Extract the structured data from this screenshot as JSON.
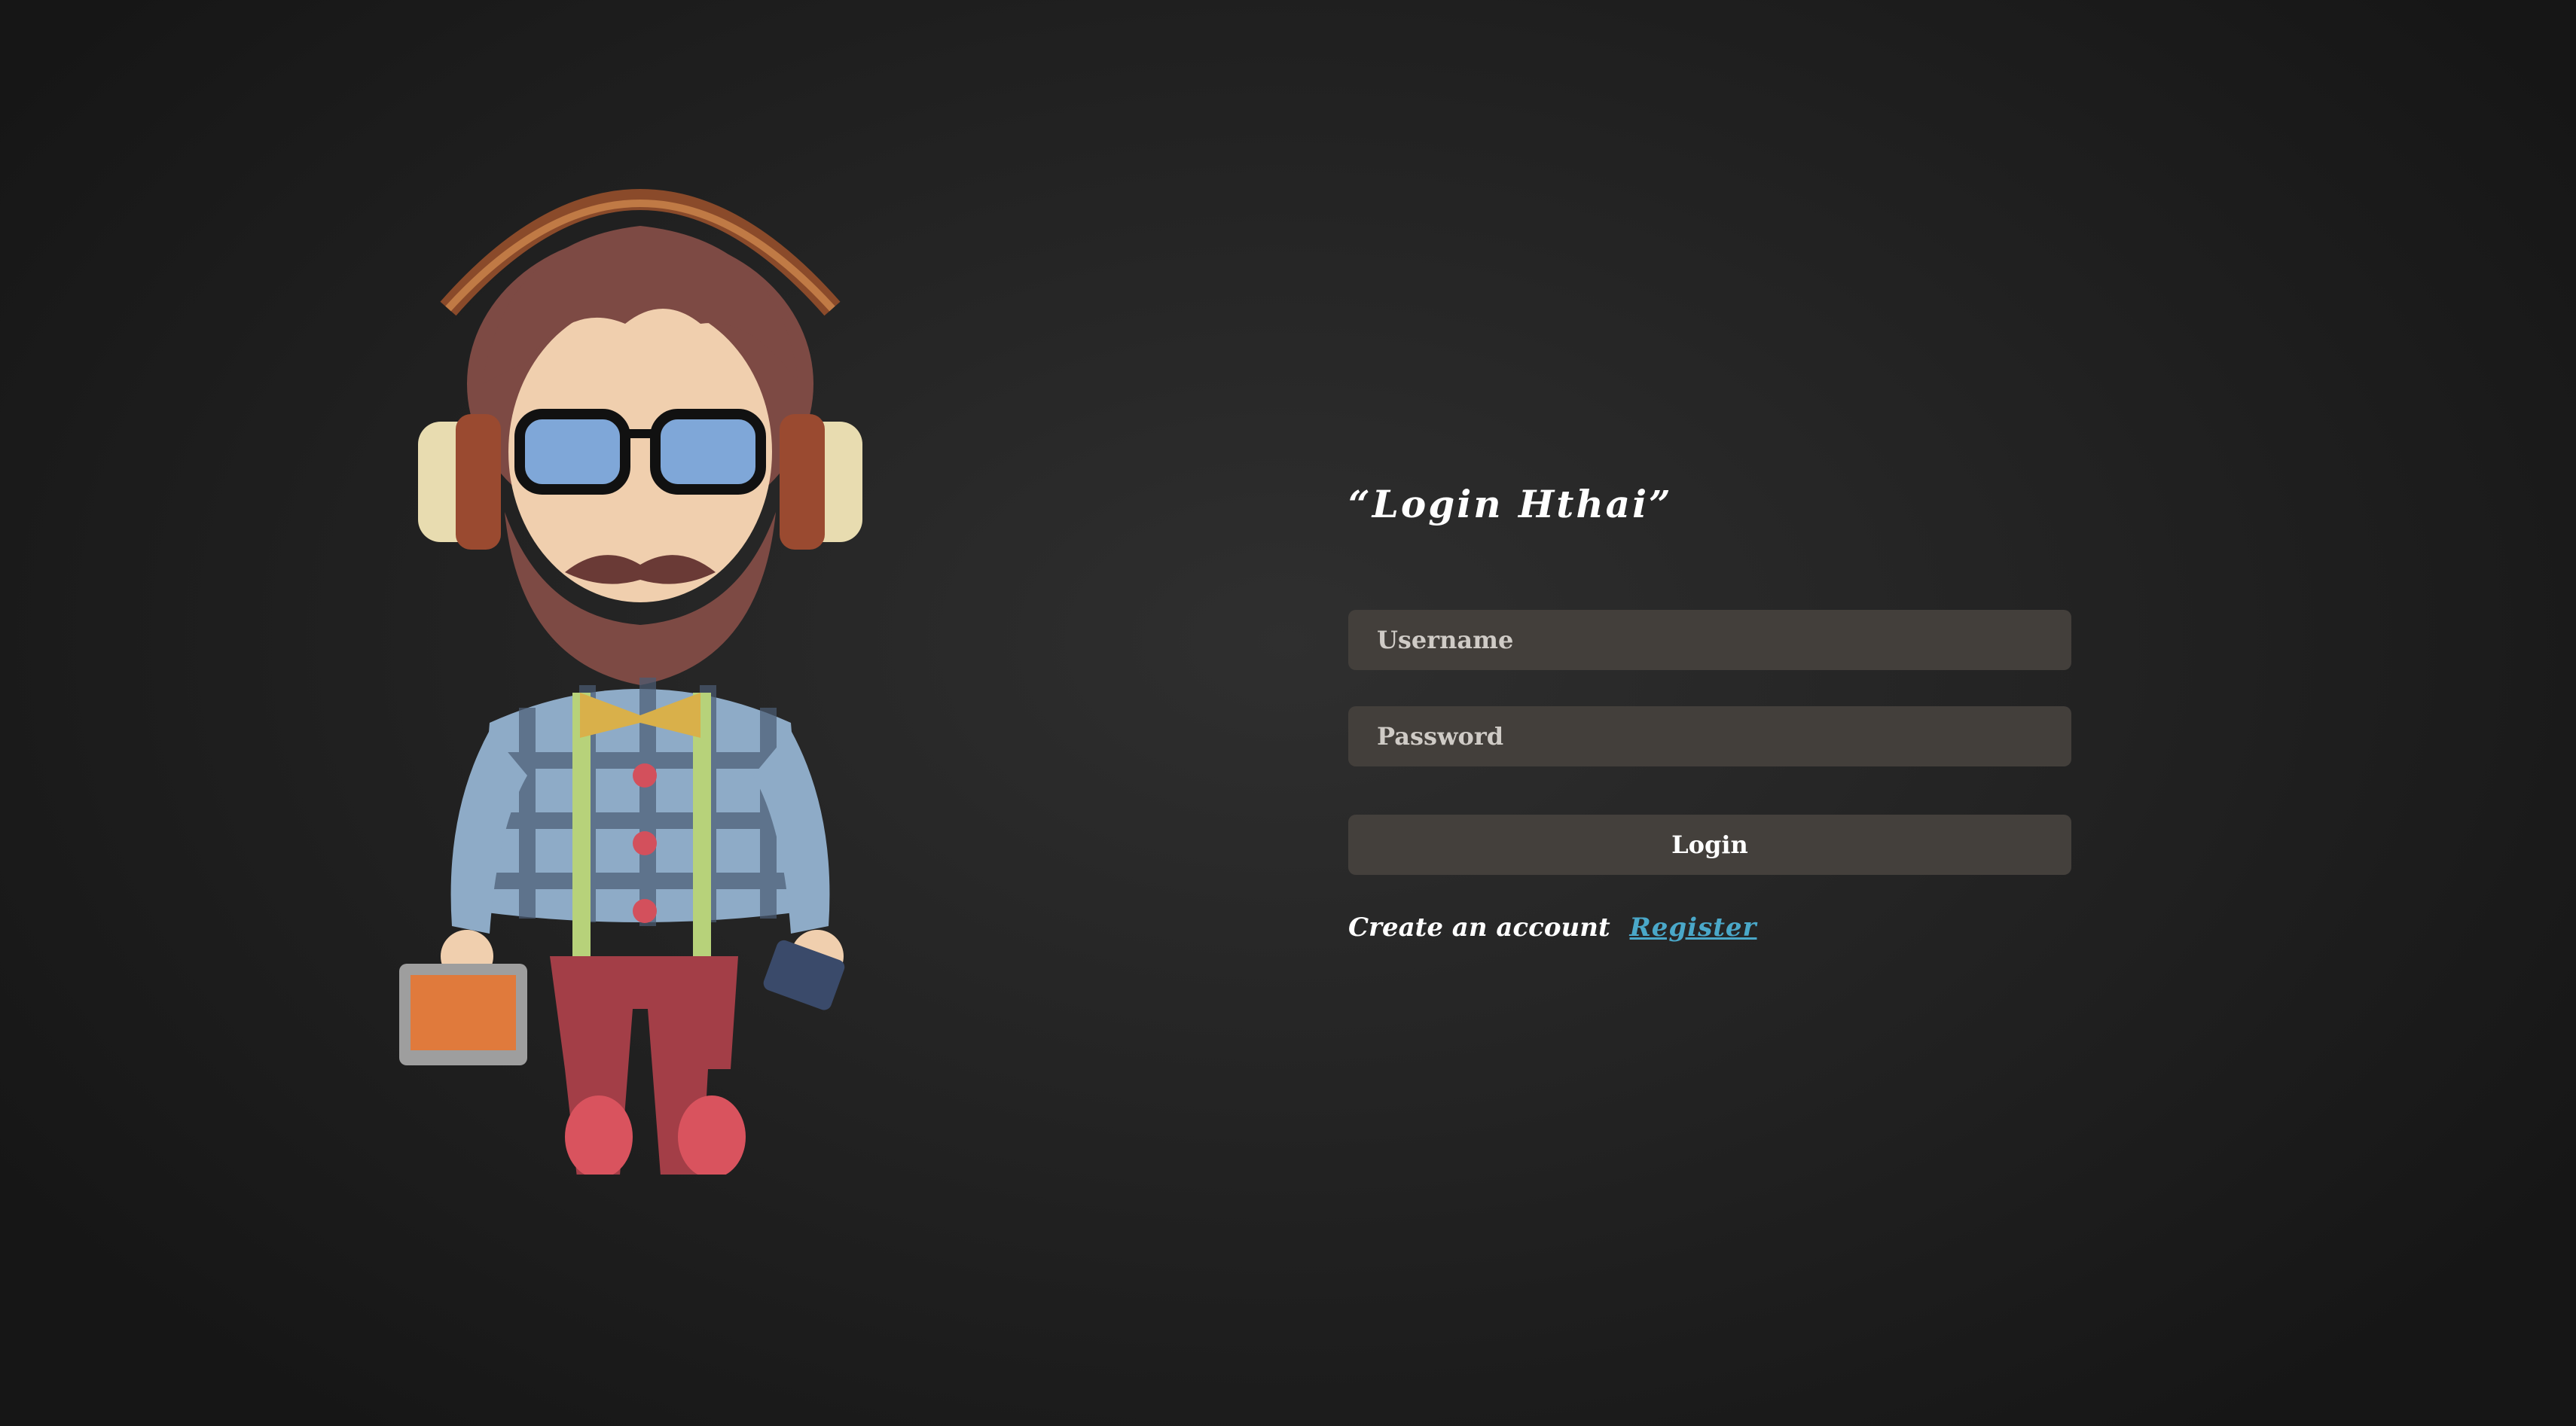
{
  "illustration": {
    "name": "hipster-character-illustration"
  },
  "login": {
    "title": "“Login Hthai”",
    "username_placeholder": "Username",
    "password_placeholder": "Password",
    "button_label": "Login",
    "create_account_text": "Create an account",
    "register_link": "Register"
  },
  "colors": {
    "background": "#1e1e1e",
    "field_bg": "#433f3b",
    "link": "#4aa8c9"
  }
}
